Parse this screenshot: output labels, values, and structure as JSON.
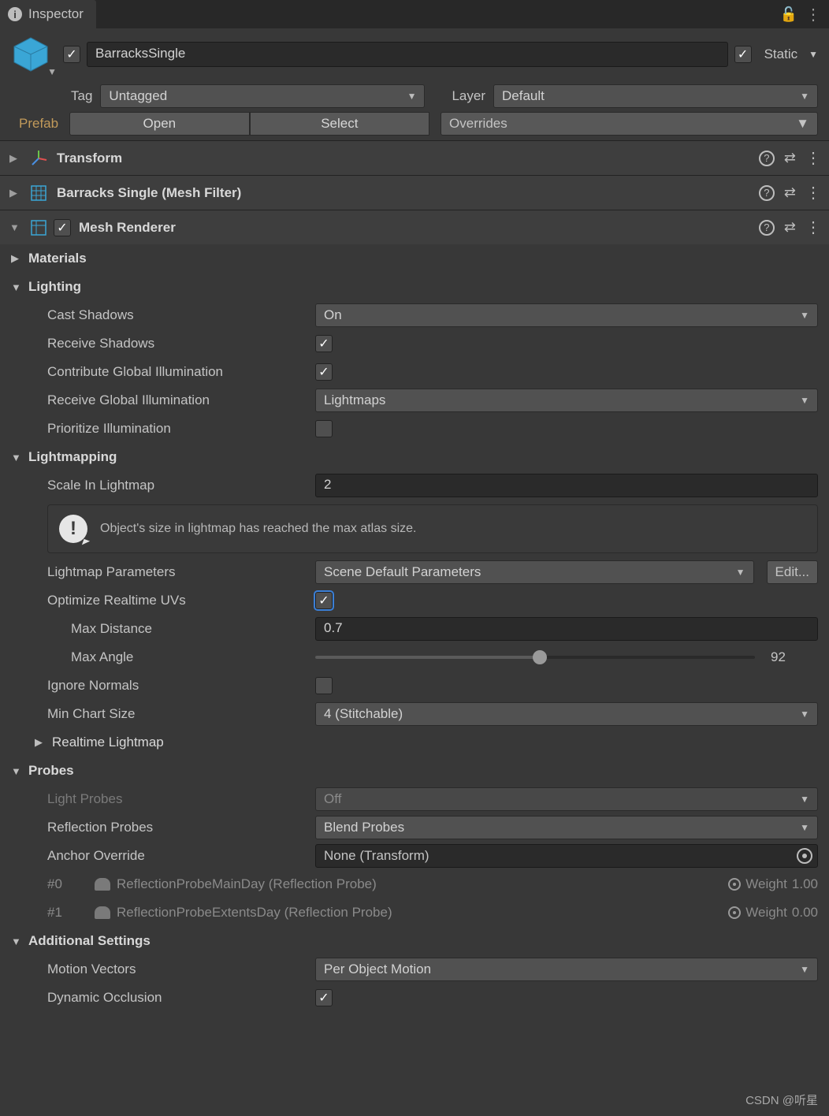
{
  "tab": {
    "title": "Inspector"
  },
  "header": {
    "name": "BarracksSingle",
    "active": true,
    "static_label": "Static",
    "static_checked": true
  },
  "tagrow": {
    "tag_label": "Tag",
    "tag_value": "Untagged",
    "layer_label": "Layer",
    "layer_value": "Default"
  },
  "prefab": {
    "label": "Prefab",
    "open": "Open",
    "select": "Select",
    "overrides": "Overrides"
  },
  "components": {
    "transform": "Transform",
    "meshfilter": "Barracks Single (Mesh Filter)",
    "meshrenderer": "Mesh Renderer"
  },
  "mr": {
    "materials": "Materials",
    "lighting": "Lighting",
    "cast_shadows_l": "Cast Shadows",
    "cast_shadows_v": "On",
    "receive_shadows_l": "Receive Shadows",
    "receive_shadows_v": true,
    "contrib_gi_l": "Contribute Global Illumination",
    "contrib_gi_v": true,
    "receive_gi_l": "Receive Global Illumination",
    "receive_gi_v": "Lightmaps",
    "prioritize_l": "Prioritize Illumination",
    "prioritize_v": false,
    "lightmapping": "Lightmapping",
    "scale_l": "Scale In Lightmap",
    "scale_v": "2",
    "warning": "Object's size in lightmap has reached the max atlas size.",
    "lm_params_l": "Lightmap Parameters",
    "lm_params_v": "Scene Default Parameters",
    "edit_btn": "Edit...",
    "opt_uv_l": "Optimize Realtime UVs",
    "opt_uv_v": true,
    "max_dist_l": "Max Distance",
    "max_dist_v": "0.7",
    "max_angle_l": "Max Angle",
    "max_angle_v": "92",
    "ignore_normals_l": "Ignore Normals",
    "ignore_normals_v": false,
    "min_chart_l": "Min Chart Size",
    "min_chart_v": "4 (Stitchable)",
    "realtime_lm_l": "Realtime Lightmap",
    "probes": "Probes",
    "light_probes_l": "Light Probes",
    "light_probes_v": "Off",
    "refl_probes_l": "Reflection Probes",
    "refl_probes_v": "Blend Probes",
    "anchor_l": "Anchor Override",
    "anchor_v": "None (Transform)",
    "probe0_idx": "#0",
    "probe0_name": "ReflectionProbeMainDay (Reflection Probe)",
    "probe0_weight_l": "Weight",
    "probe0_weight_v": "1.00",
    "probe1_idx": "#1",
    "probe1_name": "ReflectionProbeExtentsDay (Reflection Probe)",
    "probe1_weight_l": "Weight",
    "probe1_weight_v": "0.00",
    "additional": "Additional Settings",
    "motion_l": "Motion Vectors",
    "motion_v": "Per Object Motion",
    "dyn_occ_l": "Dynamic Occlusion",
    "dyn_occ_v": true
  },
  "watermark": "CSDN @听星"
}
